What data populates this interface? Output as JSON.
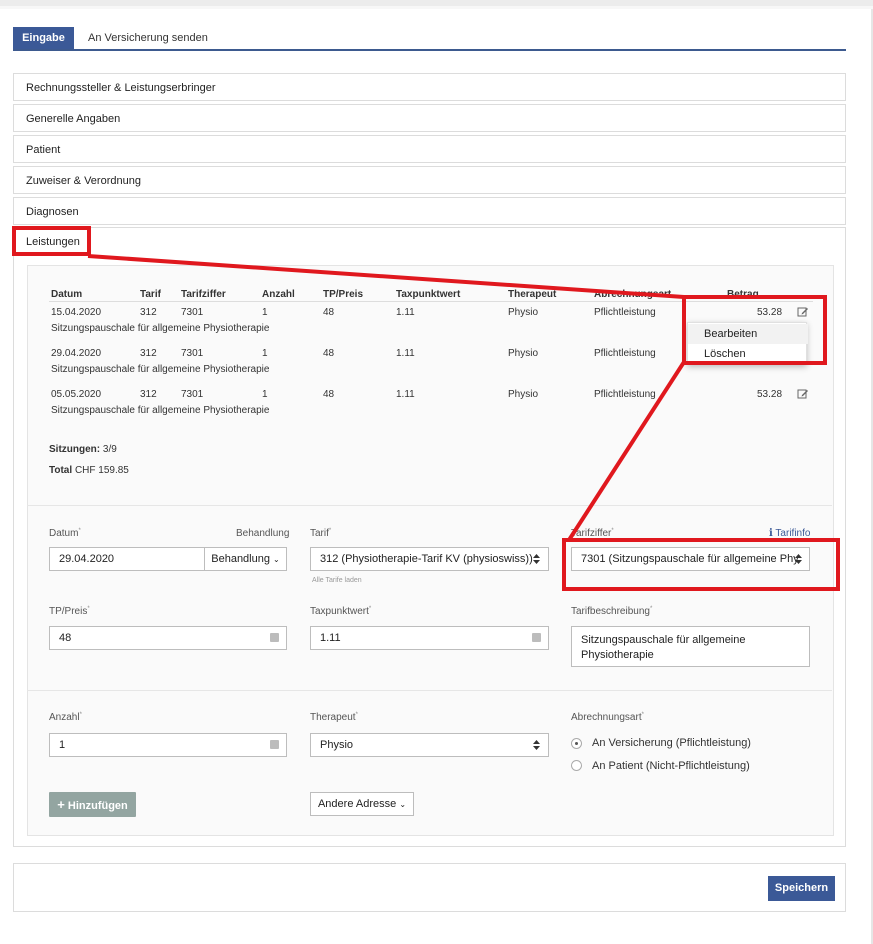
{
  "tabs": {
    "input": "Eingabe",
    "send": "An Versicherung senden"
  },
  "sections": [
    "Rechnungssteller & Leistungserbringer",
    "Generelle Angaben",
    "Patient",
    "Zuweiser & Verordnung",
    "Diagnosen",
    "Leistungen"
  ],
  "table": {
    "headers": [
      "Datum",
      "Tarif",
      "Tarifziffer",
      "Anzahl",
      "TP/Preis",
      "Taxpunktwert",
      "Therapeut",
      "Abrechnungsart",
      "Betrag"
    ],
    "rows": [
      {
        "datum": "15.04.2020",
        "tarif": "312",
        "ziffer": "7301",
        "anzahl": "1",
        "tp": "48",
        "tpw": "1.11",
        "therapeut": "Physio",
        "art": "Pflichtleistung",
        "betrag": "53.28",
        "desc": "Sitzungspauschale für allgemeine Physiotherapie"
      },
      {
        "datum": "29.04.2020",
        "tarif": "312",
        "ziffer": "7301",
        "anzahl": "1",
        "tp": "48",
        "tpw": "1.11",
        "therapeut": "Physio",
        "art": "Pflichtleistung",
        "betrag": "",
        "desc": "Sitzungspauschale für allgemeine Physiotherapie"
      },
      {
        "datum": "05.05.2020",
        "tarif": "312",
        "ziffer": "7301",
        "anzahl": "1",
        "tp": "48",
        "tpw": "1.11",
        "therapeut": "Physio",
        "art": "Pflichtleistung",
        "betrag": "53.28",
        "desc": "Sitzungspauschale für allgemeine Physiotherapie"
      }
    ],
    "visible_header_fragment": "Abrechnungsart",
    "sessions_label": "Sitzungen:",
    "sessions_value": "3/9",
    "total_label": "Total",
    "total_value": "CHF 159.85"
  },
  "context_menu": {
    "edit": "Bearbeiten",
    "delete": "Löschen"
  },
  "form": {
    "datum_label": "Datum",
    "datum_value": "29.04.2020",
    "behandlung_label": "Behandlung",
    "behandlung_btn": "Behandlung",
    "tarif_label": "Tarif",
    "tarif_value": "312 (Physiotherapie-Tarif KV (physioswiss))",
    "tarif_hint": "Alle Tarife laden",
    "tarifziffer_label": "Tarifziffer",
    "tarifinfo": "Tarifinfo",
    "tarifziffer_value": "7301 (Sitzungspauschale für allgemeine Phy",
    "tp_label": "TP/Preis",
    "tp_value": "48",
    "tpw_label": "Taxpunktwert",
    "tpw_value": "1.11",
    "beschreibung_label": "Tarifbeschreibung",
    "beschreibung_value": "Sitzungspauschale für allgemeine Physiotherapie",
    "anzahl_label": "Anzahl",
    "anzahl_value": "1",
    "therapeut_label": "Therapeut",
    "therapeut_value": "Physio",
    "abrechnung_label": "Abrechnungsart",
    "option_versicherung": "An Versicherung (Pflichtleistung)",
    "option_patient": "An Patient (Nicht-Pflichtleistung)",
    "add_button": "Hinzufügen",
    "address_button": "Andere Adresse"
  },
  "footer": {
    "save": "Speichern"
  },
  "colors": {
    "primary": "#3b5997",
    "annotation": "#e0181e",
    "add_button": "#93a5a1"
  }
}
